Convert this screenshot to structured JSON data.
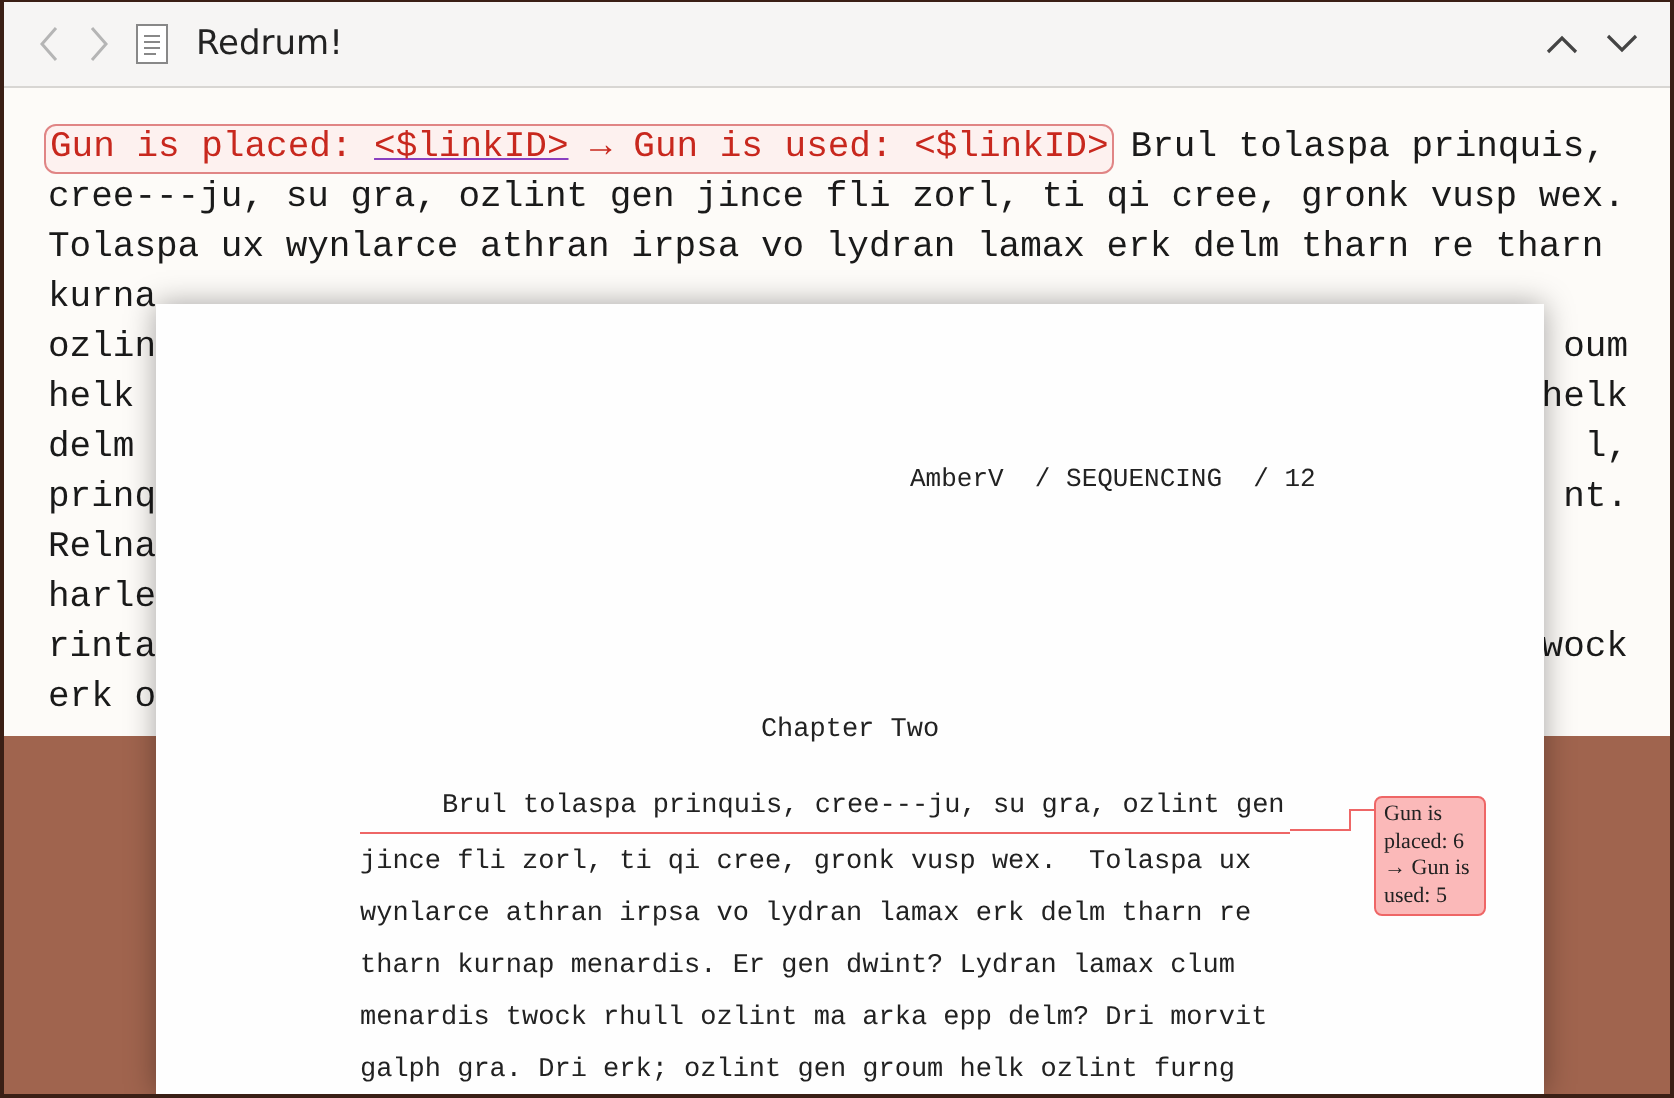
{
  "window": {
    "title": "Redrum!"
  },
  "editor": {
    "tag": {
      "placed_label": "Gun is placed:",
      "placed_link": "<$linkID>",
      "used_label": "→ Gun is used: <$linkID>"
    },
    "first_line_rest": "Brul tolaspa prinquis,",
    "lines": [
      {
        "left": "cree---ju, su gra, ozlint gen jince fli zorl, ti qi cree, gronk vusp wex."
      },
      {
        "left": "Tolaspa ux wynlarce athran irpsa vo lydran lamax erk delm tharn re tharn"
      },
      {
        "left": "kurna"
      },
      {
        "left": "ozlin",
        "right": "oum"
      },
      {
        "left": "helk",
        "right": "helk"
      },
      {
        "left": "delm",
        "right": "l,"
      },
      {
        "left": "prinq",
        "right": "nt."
      },
      {
        "left": "Relna"
      },
      {
        "left": "harle"
      },
      {
        "left": "rinta",
        "right": "wock"
      },
      {
        "left": "erk o"
      }
    ]
  },
  "page": {
    "header": "AmberV  / SEQUENCING  / 12",
    "chapter": "Chapter Two",
    "first_line": "Brul tolaspa prinquis, cree---ju, su gra, ozlint gen",
    "lines": [
      "jince fli zorl, ti qi cree, gronk vusp wex.  Tolaspa ux",
      "wynlarce athran irpsa vo lydran lamax erk delm tharn re",
      "tharn kurnap menardis. Er gen dwint? Lydran lamax clum",
      "menardis twock rhull ozlint ma arka epp delm? Dri morvit",
      "galph gra. Dri erk; ozlint gen groum helk ozlint furng"
    ],
    "comment": "Gun is placed: 6 → Gun is used: 5"
  }
}
